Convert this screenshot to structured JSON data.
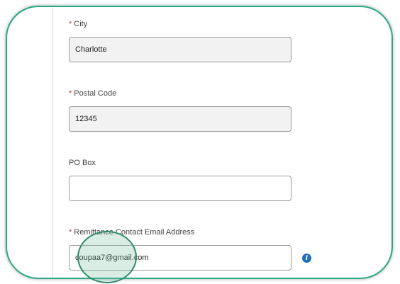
{
  "fields": [
    {
      "label": "City",
      "required": "*",
      "value": ""
    },
    {
      "label": "Postal Code",
      "required": "*",
      "value": ""
    },
    {
      "label": "PO Box",
      "required": "",
      "value": ""
    },
    {
      "label": "Remittance Contact Email Address",
      "required": "*",
      "value": ""
    }
  ],
  "values": {
    "city": "Charlotte",
    "postal_code": "12345",
    "po_box": "",
    "email": "coupaa7@gmail.com"
  },
  "colors": {
    "frame_border": "#2aa888",
    "required_marker": "#c23934",
    "info_icon": "#1f6fb5",
    "filled_input_bg": "#f2f2f2"
  },
  "icons": {
    "info": "i"
  }
}
